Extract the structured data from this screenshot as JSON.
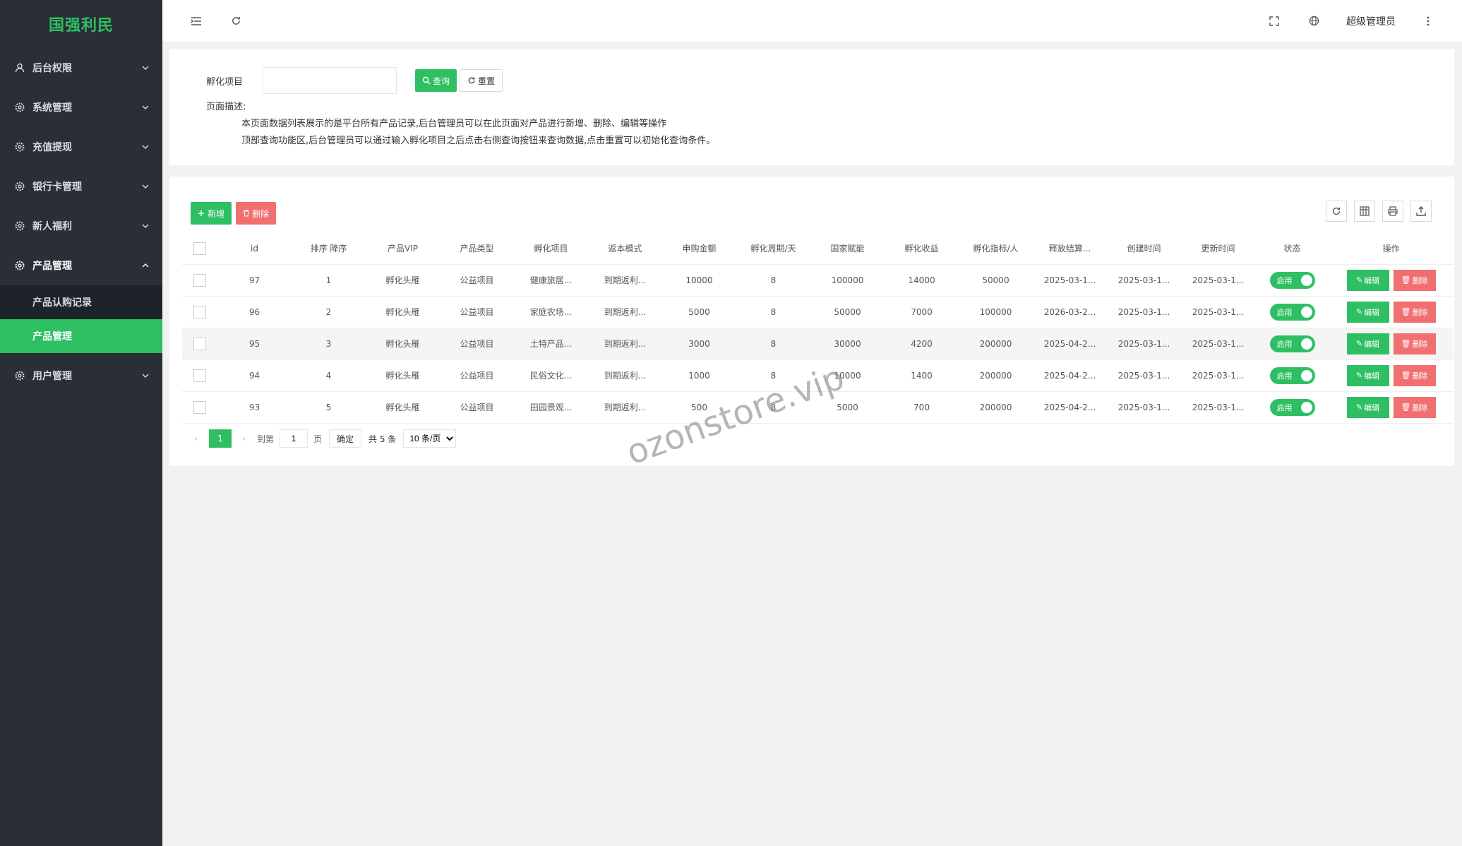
{
  "app": {
    "logo": "国强利民"
  },
  "sidebar": {
    "items": [
      {
        "label": "后台权限"
      },
      {
        "label": "系统管理"
      },
      {
        "label": "充值提现"
      },
      {
        "label": "银行卡管理"
      },
      {
        "label": "新人福利"
      },
      {
        "label": "产品管理"
      },
      {
        "label": "用户管理"
      }
    ],
    "sub_items": [
      {
        "label": "产品认购记录"
      },
      {
        "label": "产品管理"
      }
    ]
  },
  "header": {
    "user": "超级管理员"
  },
  "search": {
    "label": "孵化项目",
    "value": "",
    "query_btn": "查询",
    "reset_btn": "重置"
  },
  "description": {
    "title": "页面描述:",
    "line1": "本页面数据列表展示的是平台所有产品记录,后台管理员可以在此页面对产品进行新增、删除、编辑等操作",
    "line2": "顶部查询功能区,后台管理员可以通过输入孵化项目之后点击右侧查询按钮来查询数据,点击重置可以初始化查询条件。"
  },
  "toolbar": {
    "add": "新增",
    "delete": "删除"
  },
  "table": {
    "headers": [
      "id",
      "排序 降序",
      "产品VIP",
      "产品类型",
      "孵化项目",
      "返本模式",
      "申购金额",
      "孵化周期/天",
      "国家赋能",
      "孵化收益",
      "孵化指标/人",
      "释放结算...",
      "创建时间",
      "更新时间",
      "状态",
      "操作"
    ],
    "rows": [
      {
        "id": "97",
        "sort": "1",
        "vip": "孵化头雁",
        "type": "公益项目",
        "project": "健康旅居...",
        "mode": "到期返利...",
        "amount": "10000",
        "cycle": "8",
        "empower": "100000",
        "income": "14000",
        "quota": "50000",
        "release": "2025-03-1...",
        "created": "2025-03-1...",
        "updated": "2025-03-1...",
        "status": "启用"
      },
      {
        "id": "96",
        "sort": "2",
        "vip": "孵化头雁",
        "type": "公益项目",
        "project": "家庭农场...",
        "mode": "到期返利...",
        "amount": "5000",
        "cycle": "8",
        "empower": "50000",
        "income": "7000",
        "quota": "100000",
        "release": "2026-03-2...",
        "created": "2025-03-1...",
        "updated": "2025-03-1...",
        "status": "启用"
      },
      {
        "id": "95",
        "sort": "3",
        "vip": "孵化头雁",
        "type": "公益项目",
        "project": "土特产品...",
        "mode": "到期返利...",
        "amount": "3000",
        "cycle": "8",
        "empower": "30000",
        "income": "4200",
        "quota": "200000",
        "release": "2025-04-2...",
        "created": "2025-03-1...",
        "updated": "2025-03-1...",
        "status": "启用"
      },
      {
        "id": "94",
        "sort": "4",
        "vip": "孵化头雁",
        "type": "公益项目",
        "project": "民俗文化...",
        "mode": "到期返利...",
        "amount": "1000",
        "cycle": "8",
        "empower": "10000",
        "income": "1400",
        "quota": "200000",
        "release": "2025-04-2...",
        "created": "2025-03-1...",
        "updated": "2025-03-1...",
        "status": "启用"
      },
      {
        "id": "93",
        "sort": "5",
        "vip": "孵化头雁",
        "type": "公益项目",
        "project": "田园景观...",
        "mode": "到期返利...",
        "amount": "500",
        "cycle": "8",
        "empower": "5000",
        "income": "700",
        "quota": "200000",
        "release": "2025-04-2...",
        "created": "2025-03-1...",
        "updated": "2025-03-1...",
        "status": "启用"
      }
    ],
    "edit_label": "编辑",
    "delete_label": "删除"
  },
  "pager": {
    "current": "1",
    "goto_label": "到第",
    "page_input": "1",
    "page_unit": "页",
    "confirm": "确定",
    "total": "共 5 条",
    "per_page": "10 条/页"
  },
  "watermark": "ozonstore.vip",
  "colors": {
    "accent": "#2fbf63",
    "danger": "#f06f6f",
    "sidebar": "#2a2f37"
  }
}
